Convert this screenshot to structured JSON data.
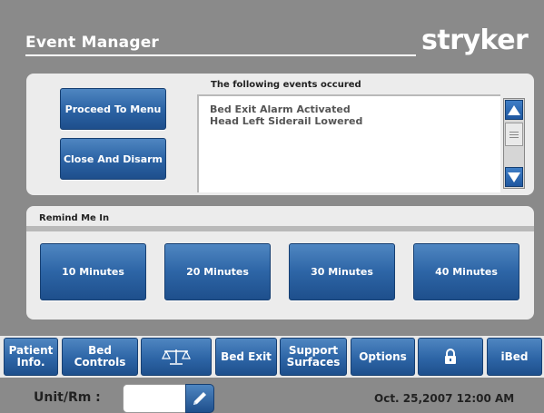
{
  "header": {
    "title": "Event Manager",
    "brand": "stryker"
  },
  "events_panel": {
    "proceed_label": "Proceed To Menu",
    "close_label": "Close And Disarm",
    "heading": "The following events occured",
    "events": [
      "Bed Exit Alarm Activated",
      "Head Left Siderail Lowered"
    ]
  },
  "remind_panel": {
    "heading": "Remind Me In",
    "options": [
      "10 Minutes",
      "20 Minutes",
      "30 Minutes",
      "40 Minutes"
    ]
  },
  "navbar": {
    "patient_info": "Patient Info.",
    "bed_controls": "Bed Controls",
    "scale_icon": "scale-icon",
    "bed_exit": "Bed Exit",
    "support_surfaces": "Support Surfaces",
    "options": "Options",
    "lock_icon": "lock-icon",
    "ibed": "iBed"
  },
  "footer": {
    "unit_label": "Unit/Rm :",
    "unit_value": "",
    "datetime": "Oct. 25,2007 12:00 AM"
  },
  "colors": {
    "background": "#8a8a8a",
    "panel": "#ececec",
    "button_blue": "#2d65a6"
  }
}
